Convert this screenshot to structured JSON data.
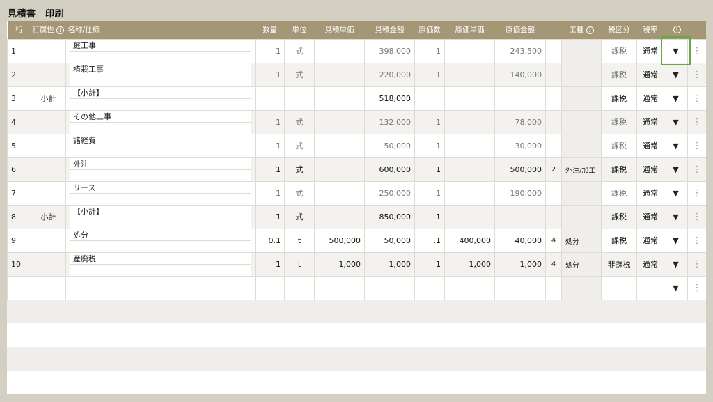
{
  "page_title": "見積書　印刷",
  "columns": [
    "行",
    "行属性",
    "名称/仕様",
    "数量",
    "単位",
    "見積単価",
    "見積金額",
    "原価数",
    "原価単価",
    "原価金額",
    "",
    "工種",
    "税区分",
    "税率",
    "",
    ""
  ],
  "rows": [
    {
      "no": "1",
      "attr": "",
      "name": "庭工事",
      "qty": "1",
      "unit": "式",
      "est_unit": "",
      "est_amount": "398,000",
      "cost_qty": "1",
      "cost_unit": "",
      "cost_amount": "243,500",
      "kind_no": "",
      "kind": "",
      "tax_class": "課税",
      "tax_rate": "通常",
      "style": "muted"
    },
    {
      "no": "2",
      "attr": "",
      "name": "植栽工事",
      "qty": "1",
      "unit": "式",
      "est_unit": "",
      "est_amount": "220,000",
      "cost_qty": "1",
      "cost_unit": "",
      "cost_amount": "140,000",
      "kind_no": "",
      "kind": "",
      "tax_class": "課税",
      "tax_rate": "通常",
      "style": "muted"
    },
    {
      "no": "3",
      "attr": "小計",
      "name": "【小計】",
      "qty": "",
      "unit": "",
      "est_unit": "",
      "est_amount": "518,000",
      "cost_qty": "",
      "cost_unit": "",
      "cost_amount": "",
      "kind_no": "",
      "kind": "",
      "tax_class": "課税",
      "tax_rate": "通常",
      "style": "bold"
    },
    {
      "no": "4",
      "attr": "",
      "name": "その他工事",
      "qty": "1",
      "unit": "式",
      "est_unit": "",
      "est_amount": "132,000",
      "cost_qty": "1",
      "cost_unit": "",
      "cost_amount": "78,000",
      "kind_no": "",
      "kind": "",
      "tax_class": "課税",
      "tax_rate": "通常",
      "style": "muted"
    },
    {
      "no": "5",
      "attr": "",
      "name": "諸経費",
      "qty": "1",
      "unit": "式",
      "est_unit": "",
      "est_amount": "50,000",
      "cost_qty": "1",
      "cost_unit": "",
      "cost_amount": "30,000",
      "kind_no": "",
      "kind": "",
      "tax_class": "課税",
      "tax_rate": "通常",
      "style": "muted"
    },
    {
      "no": "6",
      "attr": "",
      "name": "外注",
      "qty": "1",
      "unit": "式",
      "est_unit": "",
      "est_amount": "600,000",
      "cost_qty": "1",
      "cost_unit": "",
      "cost_amount": "500,000",
      "kind_no": "2",
      "kind": "外注/加工",
      "tax_class": "課税",
      "tax_rate": "通常",
      "style": "bold"
    },
    {
      "no": "7",
      "attr": "",
      "name": "リース",
      "qty": "1",
      "unit": "式",
      "est_unit": "",
      "est_amount": "250,000",
      "cost_qty": "1",
      "cost_unit": "",
      "cost_amount": "190,000",
      "kind_no": "",
      "kind": "",
      "tax_class": "課税",
      "tax_rate": "通常",
      "style": "muted"
    },
    {
      "no": "8",
      "attr": "小計",
      "name": "【小計】",
      "qty": "1",
      "unit": "式",
      "est_unit": "",
      "est_amount": "850,000",
      "cost_qty": "1",
      "cost_unit": "",
      "cost_amount": "",
      "kind_no": "",
      "kind": "",
      "tax_class": "課税",
      "tax_rate": "通常",
      "style": "bold"
    },
    {
      "no": "9",
      "attr": "",
      "name": "処分",
      "qty": "0.1",
      "unit": "t",
      "est_unit": "500,000",
      "est_amount": "50,000",
      "cost_qty": ".1",
      "cost_unit": "400,000",
      "cost_amount": "40,000",
      "kind_no": "4",
      "kind": "処分",
      "tax_class": "課税",
      "tax_rate": "通常",
      "style": "bold"
    },
    {
      "no": "10",
      "attr": "",
      "name": "産廃税",
      "qty": "1",
      "unit": "t",
      "est_unit": "1,000",
      "est_amount": "1,000",
      "cost_qty": "1",
      "cost_unit": "1,000",
      "cost_amount": "1,000",
      "kind_no": "4",
      "kind": "処分",
      "tax_class": "非課税",
      "tax_rate": "通常",
      "style": "bold"
    },
    {
      "no": "",
      "attr": "",
      "name": "",
      "qty": "",
      "unit": "",
      "est_unit": "",
      "est_amount": "",
      "cost_qty": "",
      "cost_unit": "",
      "cost_amount": "",
      "kind_no": "",
      "kind": "",
      "tax_class": "",
      "tax_rate": "",
      "style": "bold"
    }
  ],
  "icons": {
    "info": "i",
    "dropdown": "▼",
    "menu": "⋮"
  },
  "colors": {
    "header_bg": "#a59776",
    "highlight": "#6aa641",
    "page_bg": "#d4cfc3"
  }
}
